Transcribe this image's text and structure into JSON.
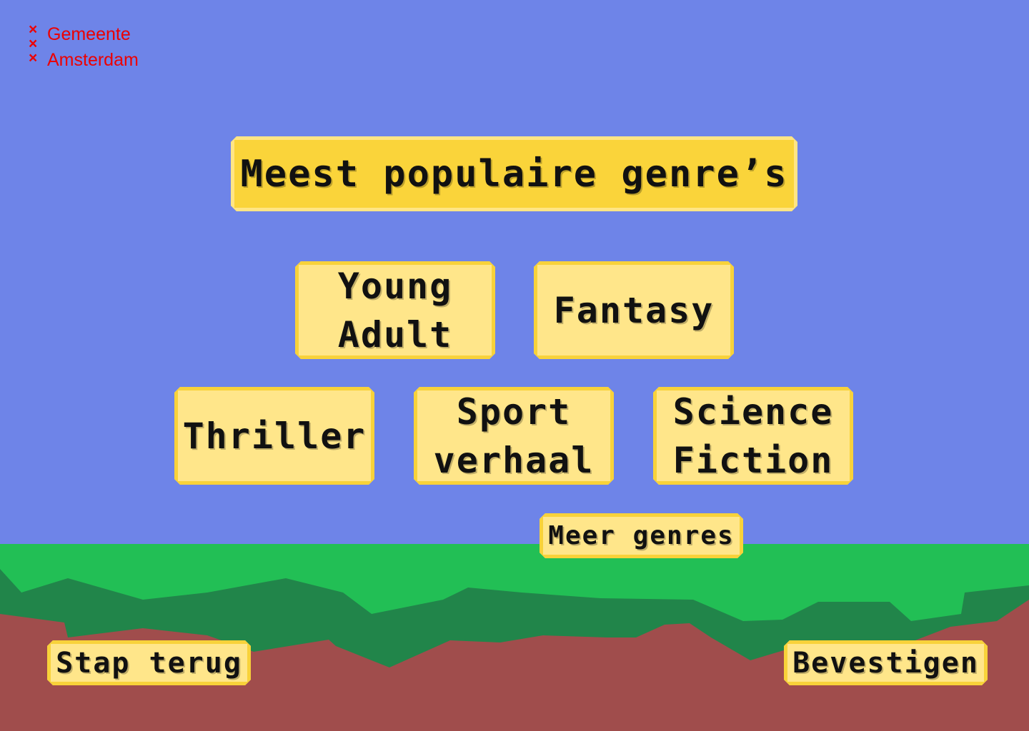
{
  "brand": {
    "line1": "Gemeente",
    "line2": "Amsterdam",
    "cross_glyph": "×",
    "color": "#ec0000"
  },
  "heading": "Meest populaire genre’s",
  "genres": [
    {
      "label": "Young\nAdult"
    },
    {
      "label": "Fantasy"
    },
    {
      "label": "Thriller"
    },
    {
      "label": "Sport\nverhaal"
    },
    {
      "label": "Science\nFiction"
    }
  ],
  "more_genres_label": "Meer genres",
  "back_label": "Stap terug",
  "confirm_label": "Bevestigen",
  "colors": {
    "sky": "#6e84e8",
    "grass": "#22bf55",
    "dark_grass": "#21854a",
    "soil": "#a04d4c",
    "tile": "#ffe68a",
    "tile_border": "#f8d23a"
  }
}
